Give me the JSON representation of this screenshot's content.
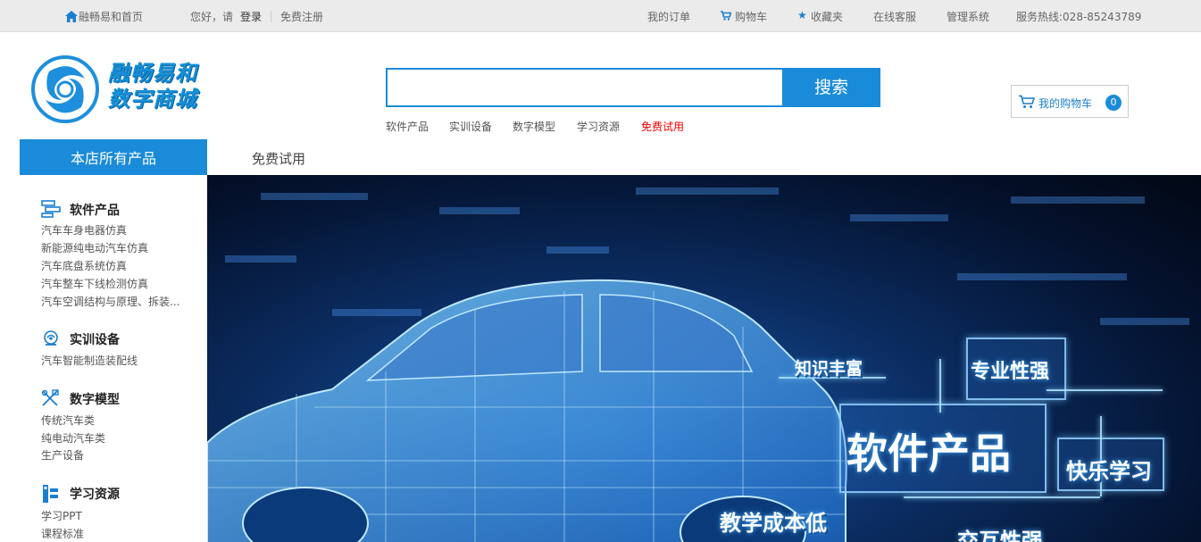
{
  "topbar": {
    "home": "融畅易和首页",
    "greeting": "您好，请",
    "login": "登录",
    "register": "免费注册",
    "orders": "我的订单",
    "cart": "购物车",
    "favorites": "收藏夹",
    "service": "在线客服",
    "admin": "管理系统",
    "hotline": "服务热线:028-85243789"
  },
  "logo": {
    "line1": "融畅易和",
    "line2": "数字商城"
  },
  "search": {
    "value": "",
    "button": "搜索",
    "hotwords": [
      "软件产品",
      "实训设备",
      "数字模型",
      "学习资源",
      "免费试用"
    ]
  },
  "mycart": {
    "label": "我的购物车",
    "count": "0"
  },
  "nav": {
    "all_products": "本店所有产品",
    "free_trial": "免费试用"
  },
  "sidebar": {
    "categories": [
      {
        "title": "软件产品",
        "icon": "software-icon",
        "items": [
          "汽车车身电器仿真",
          "新能源纯电动汽车仿真",
          "汽车底盘系统仿真",
          "汽车整车下线检测仿真",
          "汽车空调结构与原理、拆装..."
        ]
      },
      {
        "title": "实训设备",
        "icon": "training-equipment-icon",
        "items": [
          "汽车智能制造装配线"
        ]
      },
      {
        "title": "数字模型",
        "icon": "digital-model-icon",
        "items": [
          "传统汽车类",
          "纯电动汽车类",
          "生产设备"
        ]
      },
      {
        "title": "学习资源",
        "icon": "learning-resources-icon",
        "items": [
          "学习PPT",
          "课程标准"
        ]
      }
    ]
  },
  "banner": {
    "tags": [
      "知识丰富",
      "专业性强",
      "软件产品",
      "快乐学习",
      "教学成本低",
      "交互性强"
    ]
  },
  "colors": {
    "accent": "#1a8bd8",
    "topbar_bg": "#ebebeb",
    "free_trial_red": "#e00000"
  }
}
